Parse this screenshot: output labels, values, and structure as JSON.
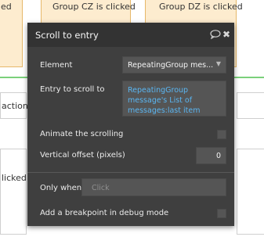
{
  "background": {
    "cards": [
      {
        "label": "ed"
      },
      {
        "label": "Group CZ is clicked"
      },
      {
        "label": "Group DZ is clicked"
      }
    ],
    "middle_row_text": "action.",
    "bottom_row_text": "licked"
  },
  "dialog": {
    "title": "Scroll to entry",
    "element_label": "Element",
    "element_value": "RepeatingGroup mes...",
    "entry_label": "Entry to scroll to",
    "entry_value_lines": [
      "RepeatingGroup",
      "message's List of",
      "messages:last item"
    ],
    "animate_label": "Animate the scrolling",
    "animate_checked": false,
    "offset_label": "Vertical offset (pixels)",
    "offset_value": "0",
    "only_when_label": "Only when",
    "only_when_placeholder": "Click",
    "breakpoint_label": "Add a breakpoint in debug mode",
    "breakpoint_checked": false
  },
  "icons": {
    "comment": "comment-icon",
    "close": "close-icon",
    "dropdown": "chevron-down-icon"
  },
  "colors": {
    "dialog_bg": "#3f3f3f",
    "header_bg": "#333333",
    "expression_text": "#5ab6f2",
    "card_bg": "#fdeccf"
  }
}
